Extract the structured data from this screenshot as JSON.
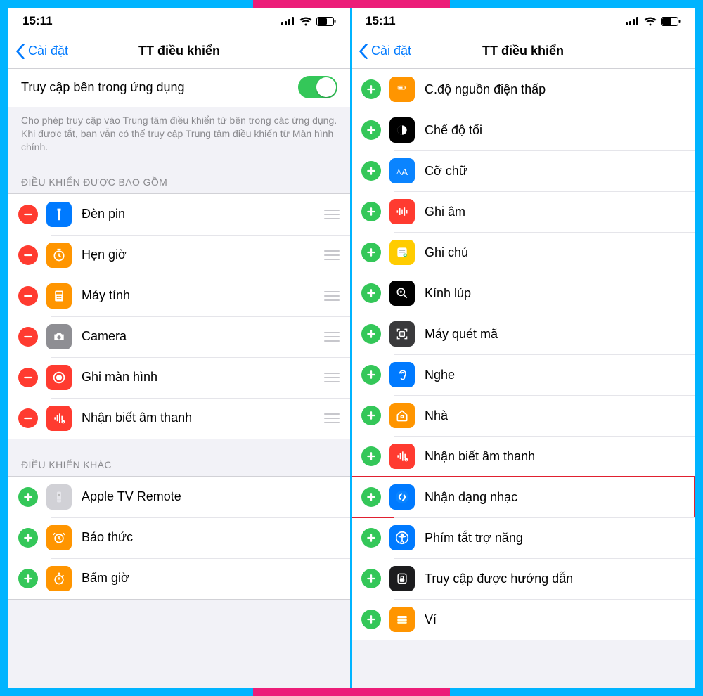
{
  "statusbar": {
    "time": "15:11"
  },
  "nav": {
    "back_label": "Cài đặt",
    "title": "TT điều khiển"
  },
  "left": {
    "toggle_label": "Truy cập bên trong ứng dụng",
    "explain": "Cho phép truy cập vào Trung tâm điều khiển từ bên trong các ứng dụng. Khi được tắt, bạn vẫn có thể truy cập Trung tâm điều khiển từ Màn hình chính.",
    "section_included": "ĐIỀU KHIỂN ĐƯỢC BAO GỒM",
    "section_more": "ĐIỀU KHIỂN KHÁC",
    "included": [
      {
        "label": "Đèn pin",
        "icon": "flashlight",
        "bg": "bg-blue"
      },
      {
        "label": "Hẹn giờ",
        "icon": "timer",
        "bg": "bg-orange"
      },
      {
        "label": "Máy tính",
        "icon": "calculator",
        "bg": "bg-orange"
      },
      {
        "label": "Camera",
        "icon": "camera",
        "bg": "bg-gray"
      },
      {
        "label": "Ghi màn hình",
        "icon": "record",
        "bg": "bg-red"
      },
      {
        "label": "Nhận biết âm thanh",
        "icon": "soundwave",
        "bg": "bg-red"
      }
    ],
    "more": [
      {
        "label": "Apple TV Remote",
        "icon": "remote",
        "bg": "bg-ltgray"
      },
      {
        "label": "Báo thức",
        "icon": "alarm",
        "bg": "bg-orange"
      },
      {
        "label": "Bấm giờ",
        "icon": "stopwatch",
        "bg": "bg-orange"
      }
    ]
  },
  "right": {
    "items": [
      {
        "label": "C.độ nguồn điện thấp",
        "icon": "battery",
        "bg": "bg-orange"
      },
      {
        "label": "Chế độ tối",
        "icon": "darkmode",
        "bg": "bg-black"
      },
      {
        "label": "Cỡ chữ",
        "icon": "textsize",
        "bg": "bg-blueA"
      },
      {
        "label": "Ghi âm",
        "icon": "voicememo",
        "bg": "bg-red"
      },
      {
        "label": "Ghi chú",
        "icon": "notes",
        "bg": "bg-yellow"
      },
      {
        "label": "Kính lúp",
        "icon": "magnifier",
        "bg": "bg-black"
      },
      {
        "label": "Máy quét mã",
        "icon": "qrcode",
        "bg": "bg-dkgray"
      },
      {
        "label": "Nghe",
        "icon": "ear",
        "bg": "bg-blue"
      },
      {
        "label": "Nhà",
        "icon": "home",
        "bg": "bg-orange"
      },
      {
        "label": "Nhận biết âm thanh",
        "icon": "soundwave",
        "bg": "bg-red"
      },
      {
        "label": "Nhận dạng nhạc",
        "icon": "shazam",
        "bg": "bg-blue",
        "highlight": true
      },
      {
        "label": "Phím tắt trợ năng",
        "icon": "accessibility",
        "bg": "bg-blue"
      },
      {
        "label": "Truy cập được hướng dẫn",
        "icon": "lock",
        "bg": "bg-dkcard"
      },
      {
        "label": "Ví",
        "icon": "wallet",
        "bg": "bg-orange"
      }
    ]
  }
}
